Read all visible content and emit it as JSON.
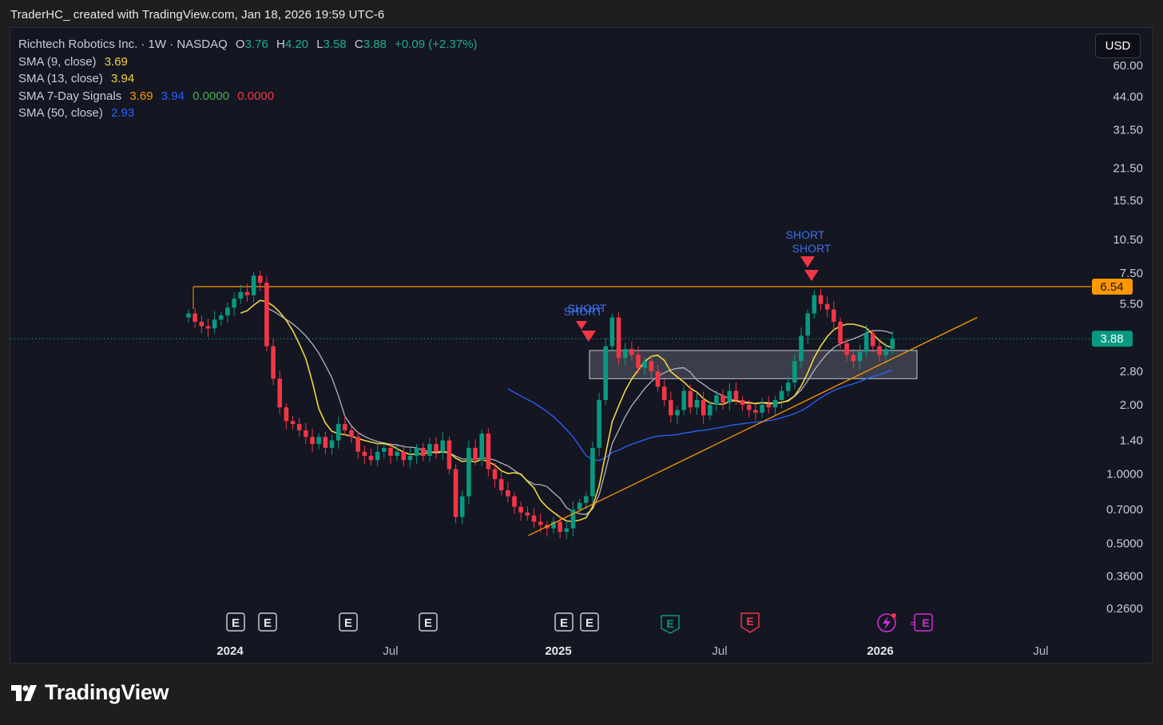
{
  "header": {
    "credit": "TraderHC_ created with TradingView.com, Jan 18, 2026 19:59 UTC-6"
  },
  "legend": {
    "symbol": "Richtech Robotics Inc. · 1W · NASDAQ",
    "open_label": "O",
    "open": "3.76",
    "high_label": "H",
    "high": "4.20",
    "low_label": "L",
    "low": "3.58",
    "close_label": "C",
    "close": "3.88",
    "change": "+0.09 (+2.37%)",
    "sma9_label": "SMA (9, close)",
    "sma9_value": "3.69",
    "sma13_label": "SMA (13, close)",
    "sma13_value": "3.94",
    "sig_label": "SMA 7-Day Signals",
    "sig_v1": "3.69",
    "sig_v2": "3.94",
    "sig_v3": "0.0000",
    "sig_v4": "0.0000",
    "sma50_label": "SMA (50, close)",
    "sma50_value": "2.93"
  },
  "currency_button": "USD",
  "footer": {
    "brand": "TradingView"
  },
  "chart_data": {
    "type": "candlestick",
    "interval": "1W",
    "y_scale": "log",
    "y_ticks": [
      "60.00",
      "44.00",
      "31.50",
      "21.50",
      "15.50",
      "10.50",
      "7.50",
      "5.50",
      "2.80",
      "2.00",
      "1.40",
      "1.0000",
      "0.7000",
      "0.5000",
      "0.3600",
      "0.2600"
    ],
    "x_ticks": [
      {
        "label": "2024",
        "bold": true
      },
      {
        "label": "Jul",
        "bold": false
      },
      {
        "label": "2025",
        "bold": true
      },
      {
        "label": "Jul",
        "bold": false
      },
      {
        "label": "2026",
        "bold": true
      },
      {
        "label": "Jul",
        "bold": false
      }
    ],
    "horizontal_line": {
      "value": 6.54,
      "label": "6.54",
      "color": "#ff9800"
    },
    "last_price": {
      "value": 3.88,
      "label": "3.88",
      "color": "#089981"
    },
    "zone": {
      "from": "2025-02",
      "to": "2026-02",
      "low": 2.6,
      "high": 3.45
    },
    "trendline": {
      "from": {
        "date": "2024-11",
        "value": 0.54
      },
      "to": {
        "date": "2026-02",
        "value": 4.8
      },
      "color": "#ff9800"
    },
    "signals": [
      {
        "label": "SHORT",
        "date": "2025-02",
        "value": 4.7
      },
      {
        "label": "SHORT",
        "date": "2025-02",
        "value": 4.5
      },
      {
        "label": "SHORT",
        "date": "2025-10",
        "value": 9.6
      },
      {
        "label": "SHORT",
        "date": "2025-10",
        "value": 8.9
      }
    ],
    "close_series": [
      5.0,
      4.6,
      4.4,
      4.3,
      4.7,
      4.9,
      5.3,
      5.8,
      6.2,
      6.0,
      7.3,
      6.8,
      3.6,
      2.6,
      1.95,
      1.7,
      1.65,
      1.55,
      1.45,
      1.35,
      1.45,
      1.3,
      1.4,
      1.65,
      1.55,
      1.45,
      1.25,
      1.2,
      1.15,
      1.25,
      1.3,
      1.2,
      1.25,
      1.15,
      1.2,
      1.3,
      1.2,
      1.35,
      1.25,
      1.4,
      1.05,
      0.65,
      0.8,
      1.3,
      1.15,
      1.5,
      1.05,
      0.95,
      0.85,
      0.8,
      0.72,
      0.68,
      0.66,
      0.62,
      0.6,
      0.58,
      0.62,
      0.56,
      0.58,
      0.7,
      0.75,
      0.8,
      1.3,
      2.1,
      3.6,
      4.8,
      3.2,
      3.5,
      3.3,
      2.9,
      3.1,
      2.8,
      2.4,
      2.1,
      1.8,
      1.9,
      2.3,
      1.95,
      2.1,
      1.8,
      2.0,
      2.2,
      2.05,
      2.3,
      2.1,
      2.0,
      1.9,
      1.85,
      2.0,
      1.95,
      2.1,
      2.3,
      2.5,
      3.1,
      4.0,
      5.0,
      6.0,
      5.5,
      5.2,
      4.6,
      3.7,
      3.3,
      3.1,
      3.4,
      4.1,
      3.6,
      3.3,
      3.5,
      3.88
    ]
  }
}
